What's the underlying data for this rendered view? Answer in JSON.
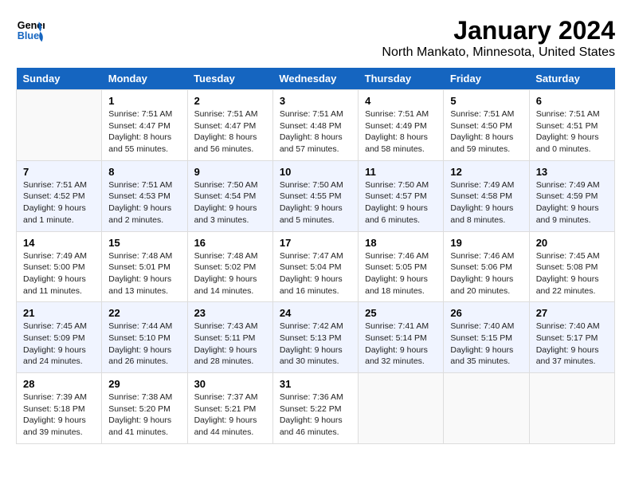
{
  "header": {
    "logo_general": "General",
    "logo_blue": "Blue",
    "title": "January 2024",
    "subtitle": "North Mankato, Minnesota, United States"
  },
  "days_of_week": [
    "Sunday",
    "Monday",
    "Tuesday",
    "Wednesday",
    "Thursday",
    "Friday",
    "Saturday"
  ],
  "weeks": [
    [
      {
        "day": "",
        "info": ""
      },
      {
        "day": "1",
        "info": "Sunrise: 7:51 AM\nSunset: 4:47 PM\nDaylight: 8 hours\nand 55 minutes."
      },
      {
        "day": "2",
        "info": "Sunrise: 7:51 AM\nSunset: 4:47 PM\nDaylight: 8 hours\nand 56 minutes."
      },
      {
        "day": "3",
        "info": "Sunrise: 7:51 AM\nSunset: 4:48 PM\nDaylight: 8 hours\nand 57 minutes."
      },
      {
        "day": "4",
        "info": "Sunrise: 7:51 AM\nSunset: 4:49 PM\nDaylight: 8 hours\nand 58 minutes."
      },
      {
        "day": "5",
        "info": "Sunrise: 7:51 AM\nSunset: 4:50 PM\nDaylight: 8 hours\nand 59 minutes."
      },
      {
        "day": "6",
        "info": "Sunrise: 7:51 AM\nSunset: 4:51 PM\nDaylight: 9 hours\nand 0 minutes."
      }
    ],
    [
      {
        "day": "7",
        "info": "Sunrise: 7:51 AM\nSunset: 4:52 PM\nDaylight: 9 hours\nand 1 minute."
      },
      {
        "day": "8",
        "info": "Sunrise: 7:51 AM\nSunset: 4:53 PM\nDaylight: 9 hours\nand 2 minutes."
      },
      {
        "day": "9",
        "info": "Sunrise: 7:50 AM\nSunset: 4:54 PM\nDaylight: 9 hours\nand 3 minutes."
      },
      {
        "day": "10",
        "info": "Sunrise: 7:50 AM\nSunset: 4:55 PM\nDaylight: 9 hours\nand 5 minutes."
      },
      {
        "day": "11",
        "info": "Sunrise: 7:50 AM\nSunset: 4:57 PM\nDaylight: 9 hours\nand 6 minutes."
      },
      {
        "day": "12",
        "info": "Sunrise: 7:49 AM\nSunset: 4:58 PM\nDaylight: 9 hours\nand 8 minutes."
      },
      {
        "day": "13",
        "info": "Sunrise: 7:49 AM\nSunset: 4:59 PM\nDaylight: 9 hours\nand 9 minutes."
      }
    ],
    [
      {
        "day": "14",
        "info": "Sunrise: 7:49 AM\nSunset: 5:00 PM\nDaylight: 9 hours\nand 11 minutes."
      },
      {
        "day": "15",
        "info": "Sunrise: 7:48 AM\nSunset: 5:01 PM\nDaylight: 9 hours\nand 13 minutes."
      },
      {
        "day": "16",
        "info": "Sunrise: 7:48 AM\nSunset: 5:02 PM\nDaylight: 9 hours\nand 14 minutes."
      },
      {
        "day": "17",
        "info": "Sunrise: 7:47 AM\nSunset: 5:04 PM\nDaylight: 9 hours\nand 16 minutes."
      },
      {
        "day": "18",
        "info": "Sunrise: 7:46 AM\nSunset: 5:05 PM\nDaylight: 9 hours\nand 18 minutes."
      },
      {
        "day": "19",
        "info": "Sunrise: 7:46 AM\nSunset: 5:06 PM\nDaylight: 9 hours\nand 20 minutes."
      },
      {
        "day": "20",
        "info": "Sunrise: 7:45 AM\nSunset: 5:08 PM\nDaylight: 9 hours\nand 22 minutes."
      }
    ],
    [
      {
        "day": "21",
        "info": "Sunrise: 7:45 AM\nSunset: 5:09 PM\nDaylight: 9 hours\nand 24 minutes."
      },
      {
        "day": "22",
        "info": "Sunrise: 7:44 AM\nSunset: 5:10 PM\nDaylight: 9 hours\nand 26 minutes."
      },
      {
        "day": "23",
        "info": "Sunrise: 7:43 AM\nSunset: 5:11 PM\nDaylight: 9 hours\nand 28 minutes."
      },
      {
        "day": "24",
        "info": "Sunrise: 7:42 AM\nSunset: 5:13 PM\nDaylight: 9 hours\nand 30 minutes."
      },
      {
        "day": "25",
        "info": "Sunrise: 7:41 AM\nSunset: 5:14 PM\nDaylight: 9 hours\nand 32 minutes."
      },
      {
        "day": "26",
        "info": "Sunrise: 7:40 AM\nSunset: 5:15 PM\nDaylight: 9 hours\nand 35 minutes."
      },
      {
        "day": "27",
        "info": "Sunrise: 7:40 AM\nSunset: 5:17 PM\nDaylight: 9 hours\nand 37 minutes."
      }
    ],
    [
      {
        "day": "28",
        "info": "Sunrise: 7:39 AM\nSunset: 5:18 PM\nDaylight: 9 hours\nand 39 minutes."
      },
      {
        "day": "29",
        "info": "Sunrise: 7:38 AM\nSunset: 5:20 PM\nDaylight: 9 hours\nand 41 minutes."
      },
      {
        "day": "30",
        "info": "Sunrise: 7:37 AM\nSunset: 5:21 PM\nDaylight: 9 hours\nand 44 minutes."
      },
      {
        "day": "31",
        "info": "Sunrise: 7:36 AM\nSunset: 5:22 PM\nDaylight: 9 hours\nand 46 minutes."
      },
      {
        "day": "",
        "info": ""
      },
      {
        "day": "",
        "info": ""
      },
      {
        "day": "",
        "info": ""
      }
    ]
  ]
}
